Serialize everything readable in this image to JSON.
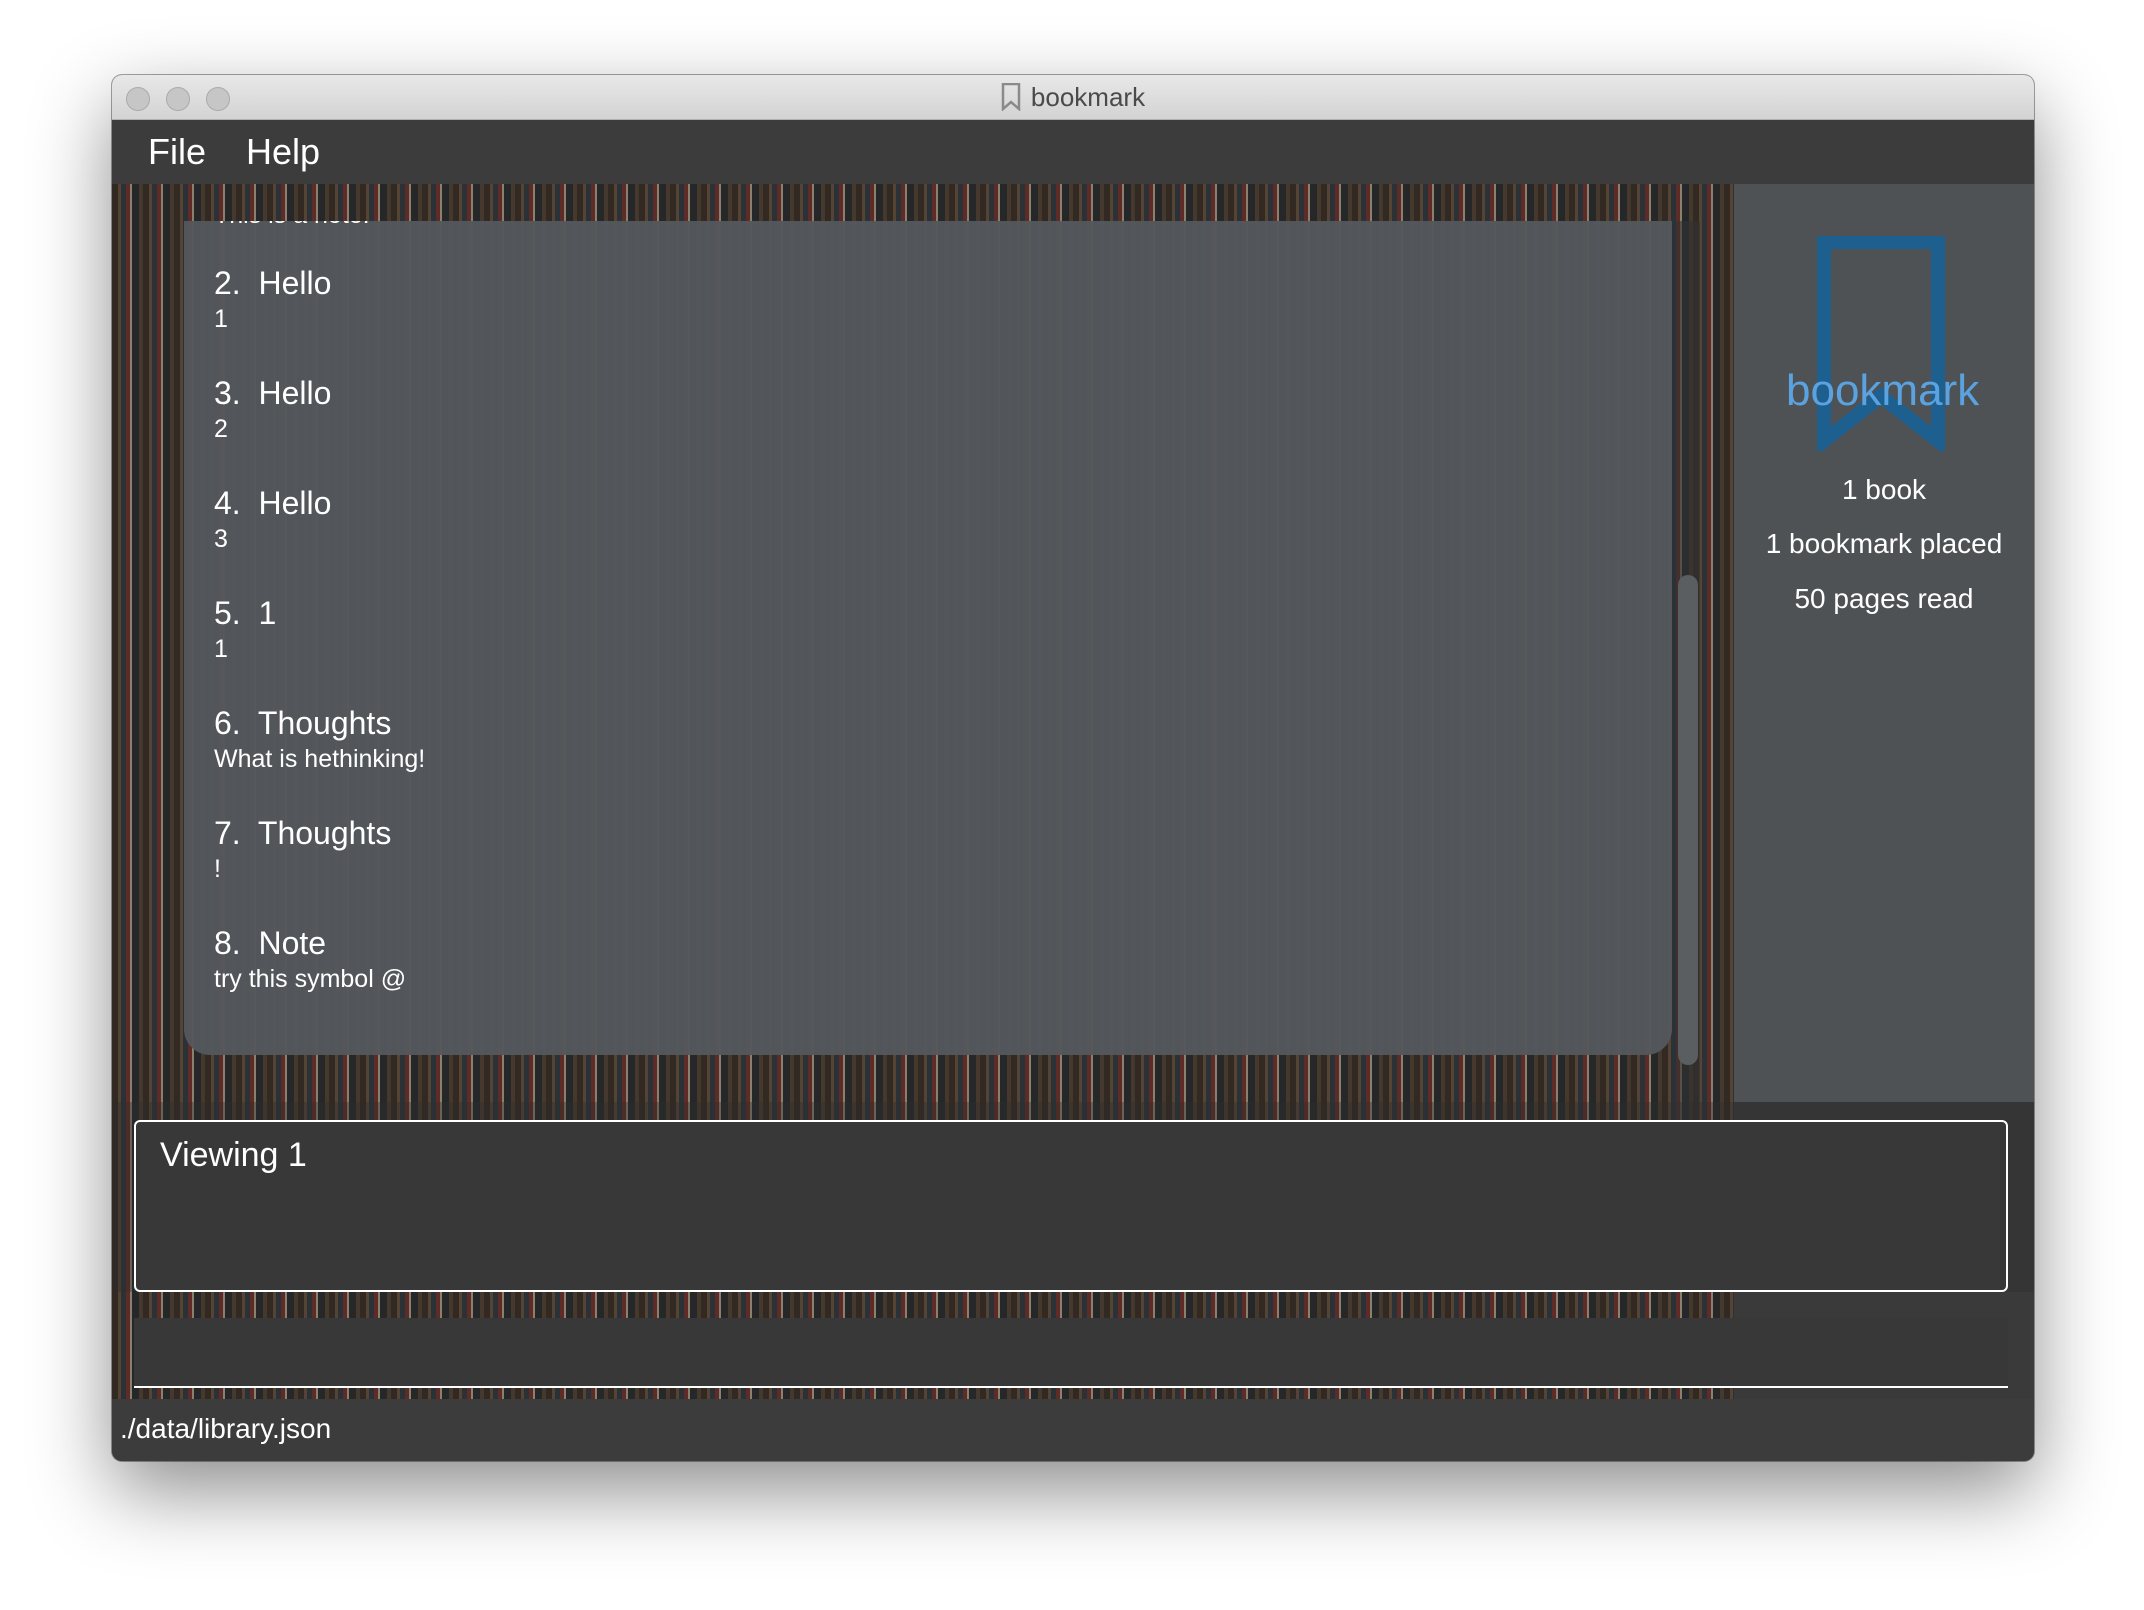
{
  "window": {
    "title": "bookmark"
  },
  "menu": {
    "file_label": "File",
    "help_label": "Help"
  },
  "list": {
    "partial_top_text": "This is a note.",
    "items": [
      {
        "index": "2.",
        "title": "Hello",
        "sub": "1"
      },
      {
        "index": "3.",
        "title": "Hello",
        "sub": "2"
      },
      {
        "index": "4.",
        "title": "Hello",
        "sub": "3"
      },
      {
        "index": "5.",
        "title": "1",
        "sub": "1"
      },
      {
        "index": "6.",
        "title": "Thoughts",
        "sub": "What is hethinking!"
      },
      {
        "index": "7.",
        "title": "Thoughts",
        "sub": "!"
      },
      {
        "index": "8.",
        "title": "Note",
        "sub": "try this symbol @"
      }
    ]
  },
  "side": {
    "logo_text": "bookmark",
    "books": "1 book",
    "bookmarks": "1 bookmark placed",
    "pages": "50 pages read",
    "logo_color": "#1d5f8f",
    "logo_text_color": "#5ba3e0"
  },
  "result": {
    "text": "Viewing 1"
  },
  "command": {
    "value": ""
  },
  "status": {
    "path": "./data/library.json"
  }
}
